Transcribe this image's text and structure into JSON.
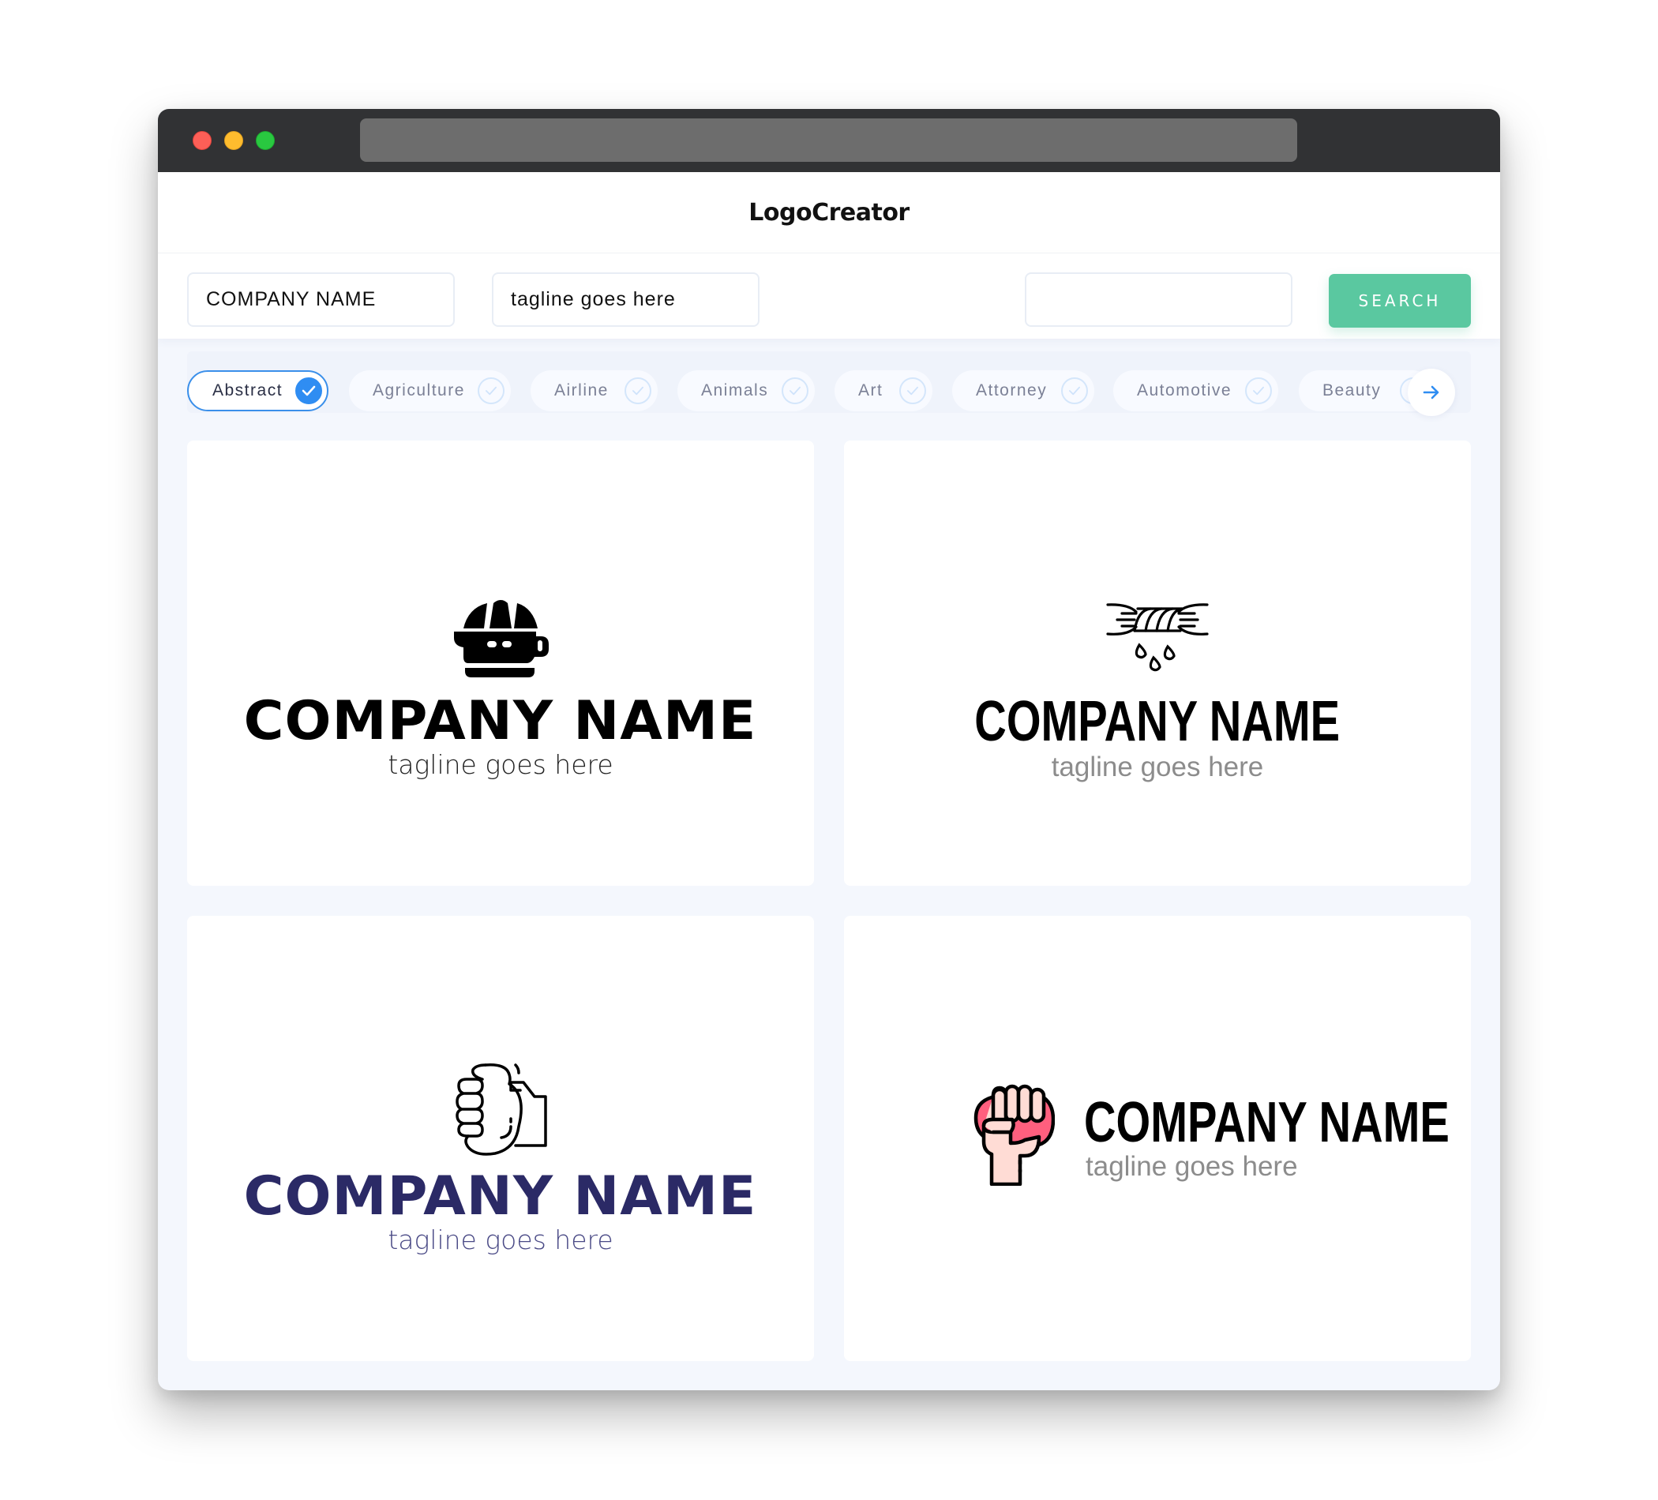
{
  "app": {
    "title": "LogoCreator",
    "window_controls": [
      "close",
      "minimize",
      "maximize"
    ]
  },
  "search": {
    "company_name_value": "COMPANY NAME",
    "tagline_value": "tagline goes here",
    "keyword_value": "",
    "search_label": "SEARCH"
  },
  "categories": {
    "items": [
      {
        "label": "Abstract",
        "selected": true
      },
      {
        "label": "Agriculture",
        "selected": false
      },
      {
        "label": "Airline",
        "selected": false
      },
      {
        "label": "Animals",
        "selected": false
      },
      {
        "label": "Art",
        "selected": false
      },
      {
        "label": "Attorney",
        "selected": false
      },
      {
        "label": "Automotive",
        "selected": false
      },
      {
        "label": "Beauty",
        "selected": false
      }
    ],
    "next_icon": "arrow-right-icon"
  },
  "logos": [
    {
      "icon": "juicer-icon",
      "company_name": "COMPANY NAME",
      "tagline": "tagline goes here",
      "name_color": "#000000",
      "tagline_color": "#222222",
      "layout": "stacked"
    },
    {
      "icon": "twisted-rope-drops-icon",
      "company_name": "COMPANY NAME",
      "tagline": "tagline goes here",
      "name_color": "#000000",
      "tagline_color": "#8c8c8c",
      "layout": "stacked"
    },
    {
      "icon": "fist-hand-icon",
      "company_name": "COMPANY NAME",
      "tagline": "tagline goes here",
      "name_color": "#2b2a66",
      "tagline_color": "#4a4a86",
      "layout": "stacked"
    },
    {
      "icon": "raised-fist-icon",
      "company_name": "COMPANY NAME",
      "tagline": "tagline goes here",
      "name_color": "#000000",
      "tagline_color": "#8c8c8c",
      "layout": "horizontal"
    }
  ],
  "colors": {
    "accent_blue": "#2f8df2",
    "search_green": "#5ac8a0",
    "titlebar": "#313234",
    "fist_pink": "#ff5f7e",
    "skin": "#ffdcd5"
  }
}
